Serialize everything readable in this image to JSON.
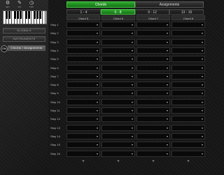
{
  "toolbar": {
    "icons": [
      {
        "name": "settings-icon",
        "glyph": "⚙",
        "label": "SET"
      },
      {
        "name": "tools-icon",
        "glyph": "✎",
        "label": "DIT"
      },
      {
        "name": "tempo-icon",
        "glyph": "◷",
        "label": "TMP"
      }
    ]
  },
  "sidebar": {
    "buttons": [
      "GLOBALS",
      "INSTRUMENTS",
      "Chords / Assignments"
    ],
    "active_index": 2,
    "badge": "ON"
  },
  "tabs": [
    "Chords",
    "Assignments"
  ],
  "active_tab": 0,
  "subtabs": [
    "1 - 4",
    "5 - 8",
    "9 - 12",
    "13 - 16"
  ],
  "active_subtab": 1,
  "columns": [
    "Chord 5",
    "Chord 6",
    "Chord 7",
    "Chord 8"
  ],
  "rows": [
    "Step 1",
    "Step 2",
    "Step 3",
    "Step 4",
    "Step 5",
    "Step 6",
    "Step 7",
    "Step 8",
    "Step 9",
    "Step 10",
    "Step 11",
    "Step 12",
    "Step 13",
    "Step 14",
    "Step 15",
    "Step 16"
  ],
  "cell_arrow": "▾",
  "plus": "+"
}
